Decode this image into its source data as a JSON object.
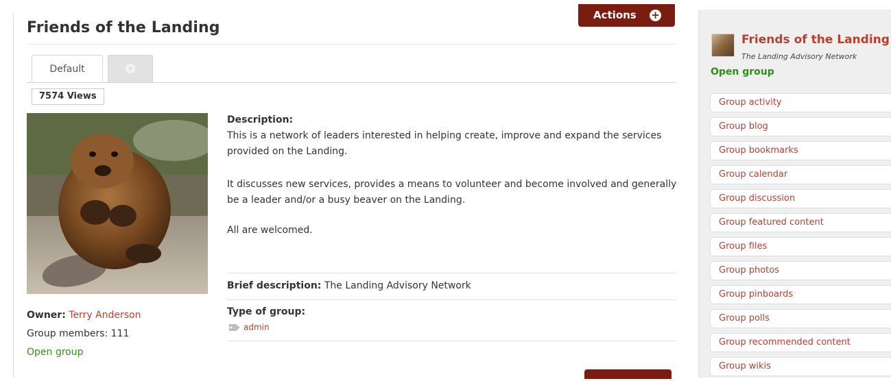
{
  "group": {
    "title": "Friends of the Landing",
    "actions_label": "Actions",
    "tabs": {
      "default_label": "Default"
    },
    "views": "7574 Views",
    "owner_label": "Owner:",
    "owner_name": "Terry Anderson",
    "members": "Group members: 111",
    "membership": "Open group",
    "description_heading": "Description:",
    "description": [
      "This is a network of leaders interested in helping create, improve and expand the services provided on the Landing.",
      "It discusses new services, provides a means to volunteer and become involved and generally be a leader and/or a busy beaver on the Landing.",
      "All are welcomed."
    ],
    "brief_label": "Brief description:",
    "brief_value": "The Landing Advisory Network",
    "type_heading": "Type of group:",
    "type_tag": "admin"
  },
  "sidebar": {
    "title": "Friends of the Landing",
    "subtitle": "The Landing Advisory Network",
    "membership": "Open group",
    "menu": [
      "Group activity",
      "Group blog",
      "Group bookmarks",
      "Group calendar",
      "Group discussion",
      "Group featured content",
      "Group files",
      "Group photos",
      "Group pinboards",
      "Group polls",
      "Group recommended content",
      "Group wikis"
    ]
  },
  "colors": {
    "accent": "#7a1d10",
    "link": "#b8402f",
    "open": "#2f8f16"
  },
  "icons": {
    "actions": "plus-circle-icon",
    "add_tab": "plus-circle-icon",
    "tag": "tag-icon"
  }
}
